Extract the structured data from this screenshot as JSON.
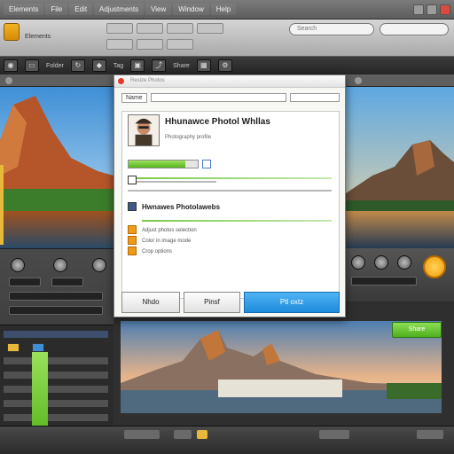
{
  "menubar": {
    "items": [
      "Elements",
      "File",
      "Edit",
      "Adjustments",
      "View",
      "Window",
      "Help"
    ]
  },
  "toolbar": {
    "status_label": "Elements",
    "search_placeholder": "Search"
  },
  "iconbar": {
    "labels": [
      "Folder",
      "Tag",
      "Share"
    ]
  },
  "dialog": {
    "title": "Resize Photos",
    "search_label": "Name",
    "profile_name": "Hhunawce Photol Whllas",
    "profile_sub": "Photography profile",
    "progress": 0.82,
    "section_title": "Hwnawes Photolawebs",
    "rows": [
      "Adjust photos selection",
      "Color in image mode",
      "Crop options"
    ],
    "buttons": {
      "cancel": "Nhdo",
      "prev": "Pinsf",
      "ok": "Ptl oxtz"
    }
  },
  "right_panel": {
    "action_label": "Share"
  },
  "colors": {
    "accent_green": "#58b51e",
    "accent_blue": "#1f8bdc",
    "accent_orange": "#f39a06"
  }
}
